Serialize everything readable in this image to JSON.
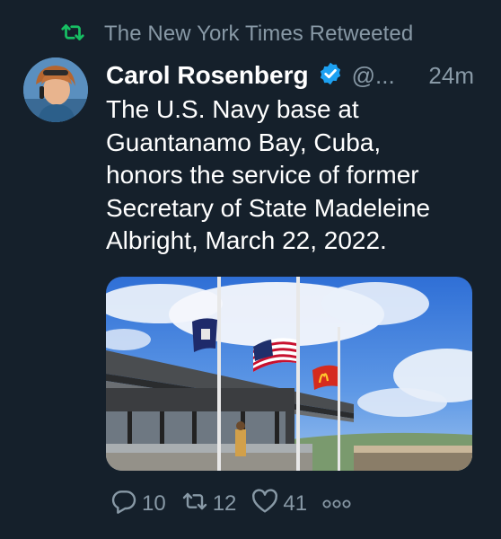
{
  "retweet": {
    "label": "The New York Times Retweeted",
    "icon": "retweet-icon",
    "icon_color": "#17bf63"
  },
  "author": {
    "name": "Carol Rosenberg",
    "handle": "@...",
    "timestamp": "24m",
    "verified": true,
    "verified_color": "#1da1f2"
  },
  "tweet": {
    "text": "The U.S. Navy base at\nGuantanamo Bay, Cuba,\nhonors the service of former\nSecretary of State Madeleine\nAlbright, March 22, 2022."
  },
  "actions": {
    "replies": "10",
    "retweets": "12",
    "likes": "41",
    "icons": [
      "reply-icon",
      "retweet-icon",
      "like-icon",
      "more-icon"
    ]
  },
  "colors": {
    "background": "#15202b",
    "secondary_text": "#8899a6",
    "primary_text": "#ffffff"
  }
}
